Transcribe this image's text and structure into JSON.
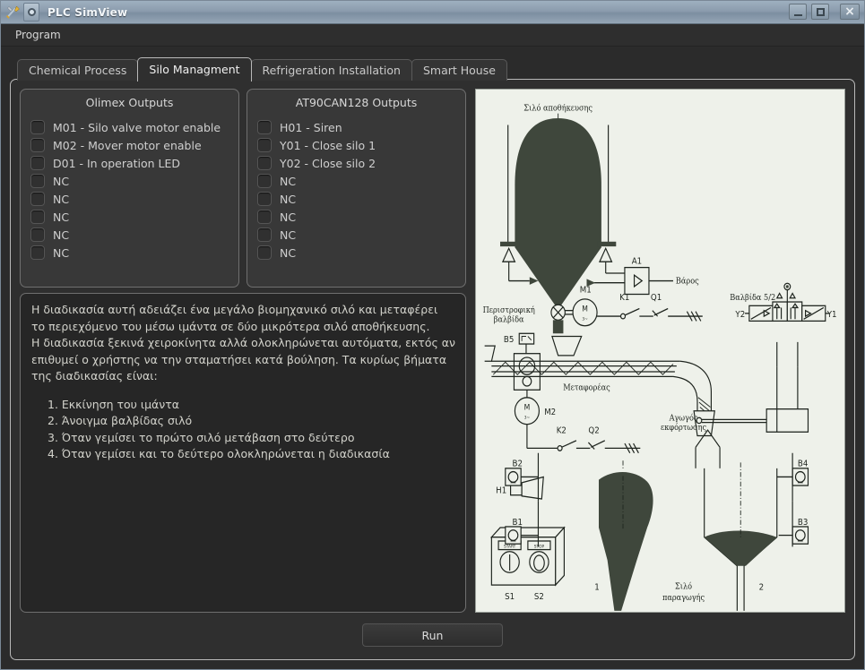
{
  "window": {
    "title": "PLC SimView",
    "icons": {
      "app": "tools-icon",
      "window_menu": "window-menu-icon",
      "minimize": "minimize-icon",
      "maximize": "maximize-icon",
      "close": "close-icon"
    },
    "buttons": {
      "minimize": "",
      "maximize": "",
      "close": "×"
    }
  },
  "menubar": {
    "items": [
      {
        "label": "Program"
      }
    ]
  },
  "tabs": [
    {
      "label": "Chemical Process",
      "active": false
    },
    {
      "label": "Silo Managment",
      "active": true
    },
    {
      "label": "Refrigeration Installation",
      "active": false
    },
    {
      "label": "Smart House",
      "active": false
    }
  ],
  "groups": [
    {
      "title": "Olimex Outputs",
      "outputs": [
        {
          "label": "M01 - Silo valve motor enable",
          "checked": false
        },
        {
          "label": "M02 - Mover motor enable",
          "checked": false
        },
        {
          "label": "D01 - In operation LED",
          "checked": false
        },
        {
          "label": "NC",
          "checked": false
        },
        {
          "label": "NC",
          "checked": false
        },
        {
          "label": "NC",
          "checked": false
        },
        {
          "label": "NC",
          "checked": false
        },
        {
          "label": "NC",
          "checked": false
        }
      ]
    },
    {
      "title": "AT90CAN128 Outputs",
      "outputs": [
        {
          "label": "H01 - Siren",
          "checked": false
        },
        {
          "label": "Y01 - Close silo 1",
          "checked": false
        },
        {
          "label": "Y02 - Close silo 2",
          "checked": false
        },
        {
          "label": "NC",
          "checked": false
        },
        {
          "label": "NC",
          "checked": false
        },
        {
          "label": "NC",
          "checked": false
        },
        {
          "label": "NC",
          "checked": false
        },
        {
          "label": "NC",
          "checked": false
        }
      ]
    }
  ],
  "description": {
    "paragraph_lines": [
      "Η διαδικασία αυτή αδειάζει ένα μεγάλο βιομηχανικό σιλό και μεταφέρει",
      "το περιεχόμενο του μέσω ιμάντα σε δύο μικρότερα σιλό αποθήκευσης.",
      "Η διαδικασία ξεκινά χειροκίνητα αλλά ολοκληρώνεται αυτόματα, εκτός αν",
      "επιθυμεί ο χρήστης να την σταματήσει κατά βούληση. Τα κυρίως βήματα",
      "της διαδικασίας είναι:"
    ],
    "steps": [
      "1. Εκκίνηση του ιμάντα",
      "2. Άνοιγμα βαλβίδας σιλό",
      "3. Όταν γεμίσει το πρώτο σιλό μετάβαση στο δεύτερο",
      "4. Όταν γεμίσει και το δεύτερο ολοκληρώνεται η διαδικασία"
    ]
  },
  "diagram": {
    "labels": {
      "storage_silo": "Σιλό αποθήκευσης",
      "rotary_valve_l1": "Περιστροφική",
      "rotary_valve_l2": "βαλβίδα",
      "conveyor": "Μεταφορέας",
      "discharge_l1": "Αγωγός",
      "discharge_l2": "εκφόρτωσης",
      "weight": "Βάρος",
      "valve52": "Βαλβίδα 5/2",
      "production_silo_l1": "Σιλό",
      "production_silo_l2": "παραγωγής",
      "a1": "A1",
      "m1": "M1",
      "m2": "M2",
      "k1": "K1",
      "q1": "Q1",
      "k2": "K2",
      "q2": "Q2",
      "b5": "B5",
      "b1": "B1",
      "b2": "B2",
      "b3": "B3",
      "b4": "B4",
      "y1": "Y1",
      "y2": "Y2",
      "h1": "H1",
      "s1": "S1",
      "s2": "S2",
      "silo_num_1": "1",
      "silo_num_2": "2",
      "motor_m1_top": "M",
      "motor_m1_bottom": "3~",
      "motor_m2_top": "M",
      "motor_m2_bottom": "3~",
      "start_button": "START",
      "stop_button": "STOP"
    },
    "colors": {
      "background": "#eef1ea",
      "ink": "#1e241e",
      "fill": "#3f473c"
    }
  },
  "footer": {
    "run_label": "Run"
  },
  "theme": {
    "window_bg": "#2b2b2b",
    "panel_bg": "#2f2f2f",
    "group_bg": "#383838",
    "desc_bg": "#262626",
    "text": "#d0d0d0",
    "titlebar_accent": "#8b9cad"
  }
}
